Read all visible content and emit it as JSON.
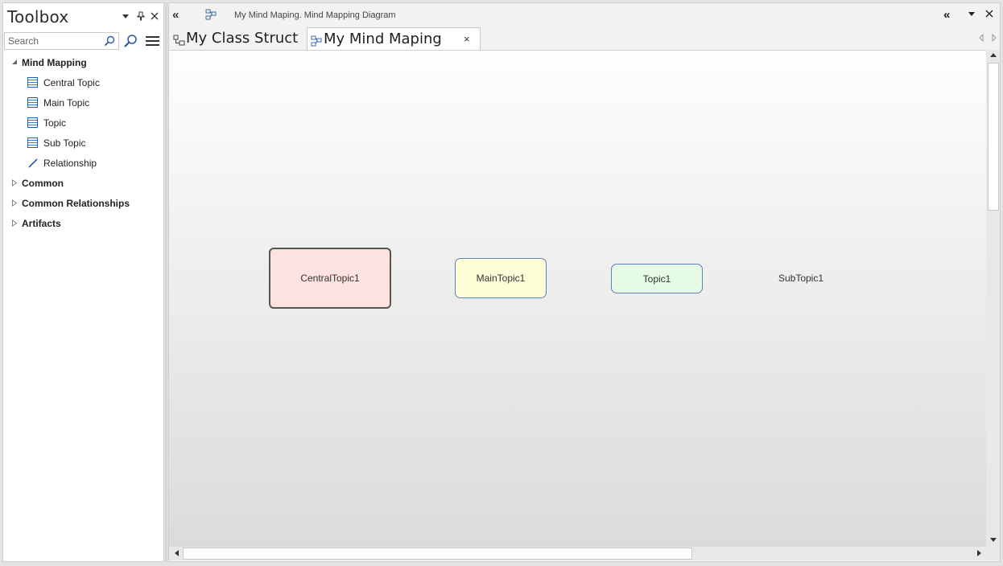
{
  "toolbox": {
    "title": "Toolbox",
    "search_placeholder": "Search",
    "groups": [
      {
        "label": "Mind Mapping",
        "expanded": true,
        "items": [
          {
            "label": "Central Topic",
            "icon": "element-icon"
          },
          {
            "label": "Main Topic",
            "icon": "element-icon"
          },
          {
            "label": "Topic",
            "icon": "element-icon"
          },
          {
            "label": "Sub Topic",
            "icon": "element-icon"
          },
          {
            "label": "Relationship",
            "icon": "connector-line-icon"
          }
        ]
      },
      {
        "label": "Common",
        "expanded": false
      },
      {
        "label": "Common Relationships",
        "expanded": false
      },
      {
        "label": "Artifacts",
        "expanded": false
      }
    ]
  },
  "diagram": {
    "path": "My Mind Maping.  Mind Mapping Diagram",
    "tabs": [
      {
        "label": "My Class Struct",
        "active": false
      },
      {
        "label": "My Mind Maping",
        "active": true,
        "close": "×"
      }
    ],
    "nodes": {
      "central": "CentralTopic1",
      "main": "MainTopic1",
      "topic": "Topic1",
      "sub": "SubTopic1"
    }
  },
  "colors": {
    "central_fill": "#fde3df",
    "main_fill": "#fefed8",
    "topic_fill": "#e5fbe5",
    "node_border": "#5f83b5"
  }
}
